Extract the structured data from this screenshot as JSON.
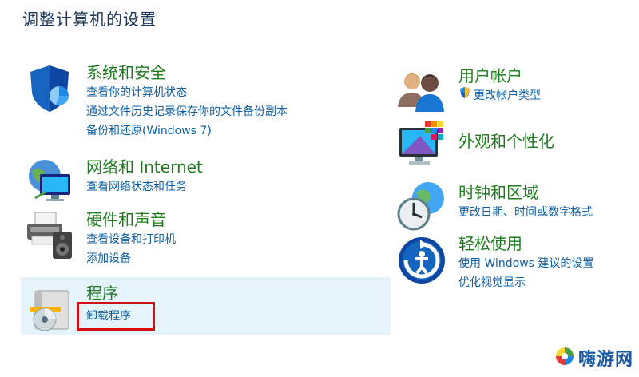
{
  "page": {
    "title": "调整计算机的设置"
  },
  "left": [
    {
      "title": "系统和安全",
      "links": [
        "查看你的计算机状态",
        "通过文件历史记录保存你的文件备份副本",
        "备份和还原(Windows 7)"
      ],
      "icon": "shield-icon"
    },
    {
      "title": "网络和 Internet",
      "links": [
        "查看网络状态和任务"
      ],
      "icon": "network-globe-icon"
    },
    {
      "title": "硬件和声音",
      "links": [
        "查看设备和打印机",
        "添加设备"
      ],
      "icon": "printer-speaker-icon"
    },
    {
      "title": "程序",
      "links": [
        "卸载程序"
      ],
      "icon": "programs-disc-icon"
    }
  ],
  "right": [
    {
      "title": "用户帐户",
      "links": [
        "更改帐户类型"
      ],
      "icon": "users-icon"
    },
    {
      "title": "外观和个性化",
      "links": [],
      "icon": "monitor-palette-icon"
    },
    {
      "title": "时钟和区域",
      "links": [
        "更改日期、时间或数字格式"
      ],
      "icon": "clock-globe-icon"
    },
    {
      "title": "轻松使用",
      "links": [
        "使用 Windows 建议的设置",
        "优化视觉显示"
      ],
      "icon": "ease-of-access-icon"
    }
  ],
  "watermark": {
    "text": "嗨游网"
  },
  "colors": {
    "title_text": "#1e395b",
    "category_green": "#1e7b1e",
    "link_blue": "#0d5fa5",
    "hover_bg": "#e5f3fb",
    "annotation_red": "#d40f14"
  }
}
